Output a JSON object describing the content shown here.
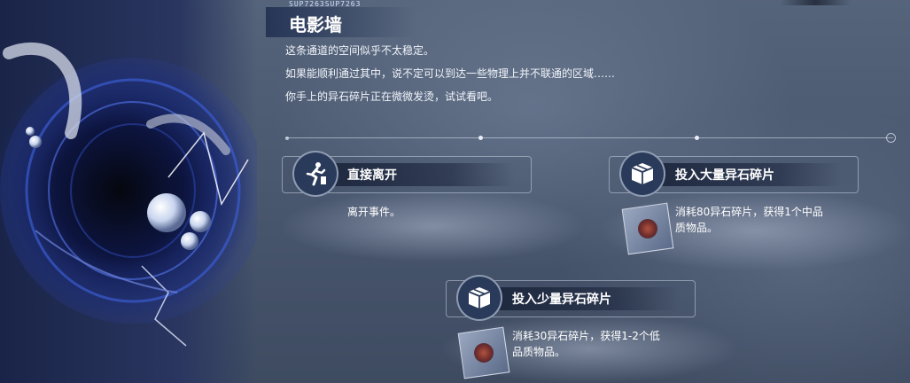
{
  "event": {
    "code": "SUP7263SUP7263",
    "title": "电影墙",
    "lines": [
      "这条通道的空间似乎不太稳定。",
      "如果能顺利通过其中，说不定可以到达一些物理上并不联通的区域……",
      "你手上的异石碎片正在微微发烫，试试看吧。"
    ]
  },
  "options": [
    {
      "label": "直接离开",
      "desc": "离开事件。",
      "icon": "running-exit-icon"
    },
    {
      "label": "投入大量异石碎片",
      "desc_line1": "消耗80异石碎片，获得1个中品",
      "desc_line2": "质物品。",
      "icon": "box-icon"
    },
    {
      "label": "投入少量异石碎片",
      "desc_line1": "消耗30异石碎片，获得1-2个低",
      "desc_line2": "品质物品。",
      "icon": "box-icon"
    }
  ],
  "colors": {
    "accent": "#2a3a5a",
    "text": "#ffffff",
    "background": "#4a5870"
  }
}
